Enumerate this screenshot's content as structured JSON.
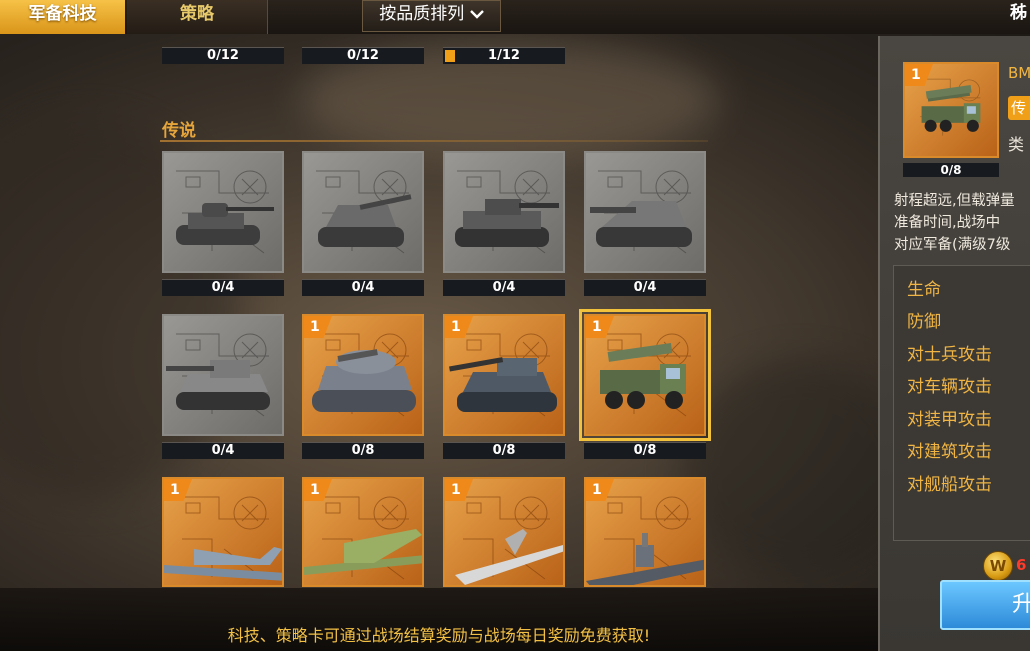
{
  "topbar": {
    "tab_active": "军备科技",
    "tab_strategy": "策略",
    "sort_label": "按品质排列",
    "right_partial": "秭"
  },
  "top_progress": [
    {
      "label": "0/12",
      "fill": 0
    },
    {
      "label": "0/12",
      "fill": 0
    },
    {
      "label": "1/12",
      "fill": 0.083
    }
  ],
  "section": {
    "title": "传说"
  },
  "cards": [
    {
      "progress": "0/4",
      "level": "",
      "unit": "tank-t34-icon",
      "grey": true
    },
    {
      "progress": "0/4",
      "level": "",
      "unit": "spg-icon",
      "grey": true
    },
    {
      "progress": "0/4",
      "level": "",
      "unit": "tiger-tank-icon",
      "grey": true
    },
    {
      "progress": "0/4",
      "level": "",
      "unit": "tank-destroyer-icon",
      "grey": true
    },
    {
      "progress": "0/4",
      "level": "",
      "unit": "king-tiger-icon",
      "grey": true
    },
    {
      "progress": "0/8",
      "level": "1",
      "unit": "maus-tank-icon",
      "grey": false
    },
    {
      "progress": "0/8",
      "level": "1",
      "unit": "e100-tank-icon",
      "grey": false
    },
    {
      "progress": "0/8",
      "level": "1",
      "unit": "rocket-truck-icon",
      "grey": false,
      "selected": true
    },
    {
      "progress": "",
      "level": "1",
      "unit": "bomber-plane-icon",
      "grey": false
    },
    {
      "progress": "",
      "level": "1",
      "unit": "transport-plane-icon",
      "grey": false
    },
    {
      "progress": "",
      "level": "1",
      "unit": "jet-plane-icon",
      "grey": false
    },
    {
      "progress": "",
      "level": "1",
      "unit": "battleship-icon",
      "grey": false
    }
  ],
  "bottom": {
    "tip": "科技、策略卡可通过战场结算奖励与战场每日奖励免费获取!"
  },
  "detail": {
    "level": "1",
    "progress": "0/8",
    "name_partial": "BM",
    "rarity_partial": "传",
    "type_partial": "类",
    "desc_lines": [
      "射程超远,但载弹量",
      "准备时间,战场中",
      "对应军备(满级7级"
    ],
    "stats": [
      "生命",
      "防御",
      "对士兵攻击",
      "对车辆攻击",
      "对装甲攻击",
      "对建筑攻击",
      "对舰船攻击"
    ],
    "coin_symbol": "W",
    "coin_partial": "6",
    "upgrade_partial": "升"
  }
}
